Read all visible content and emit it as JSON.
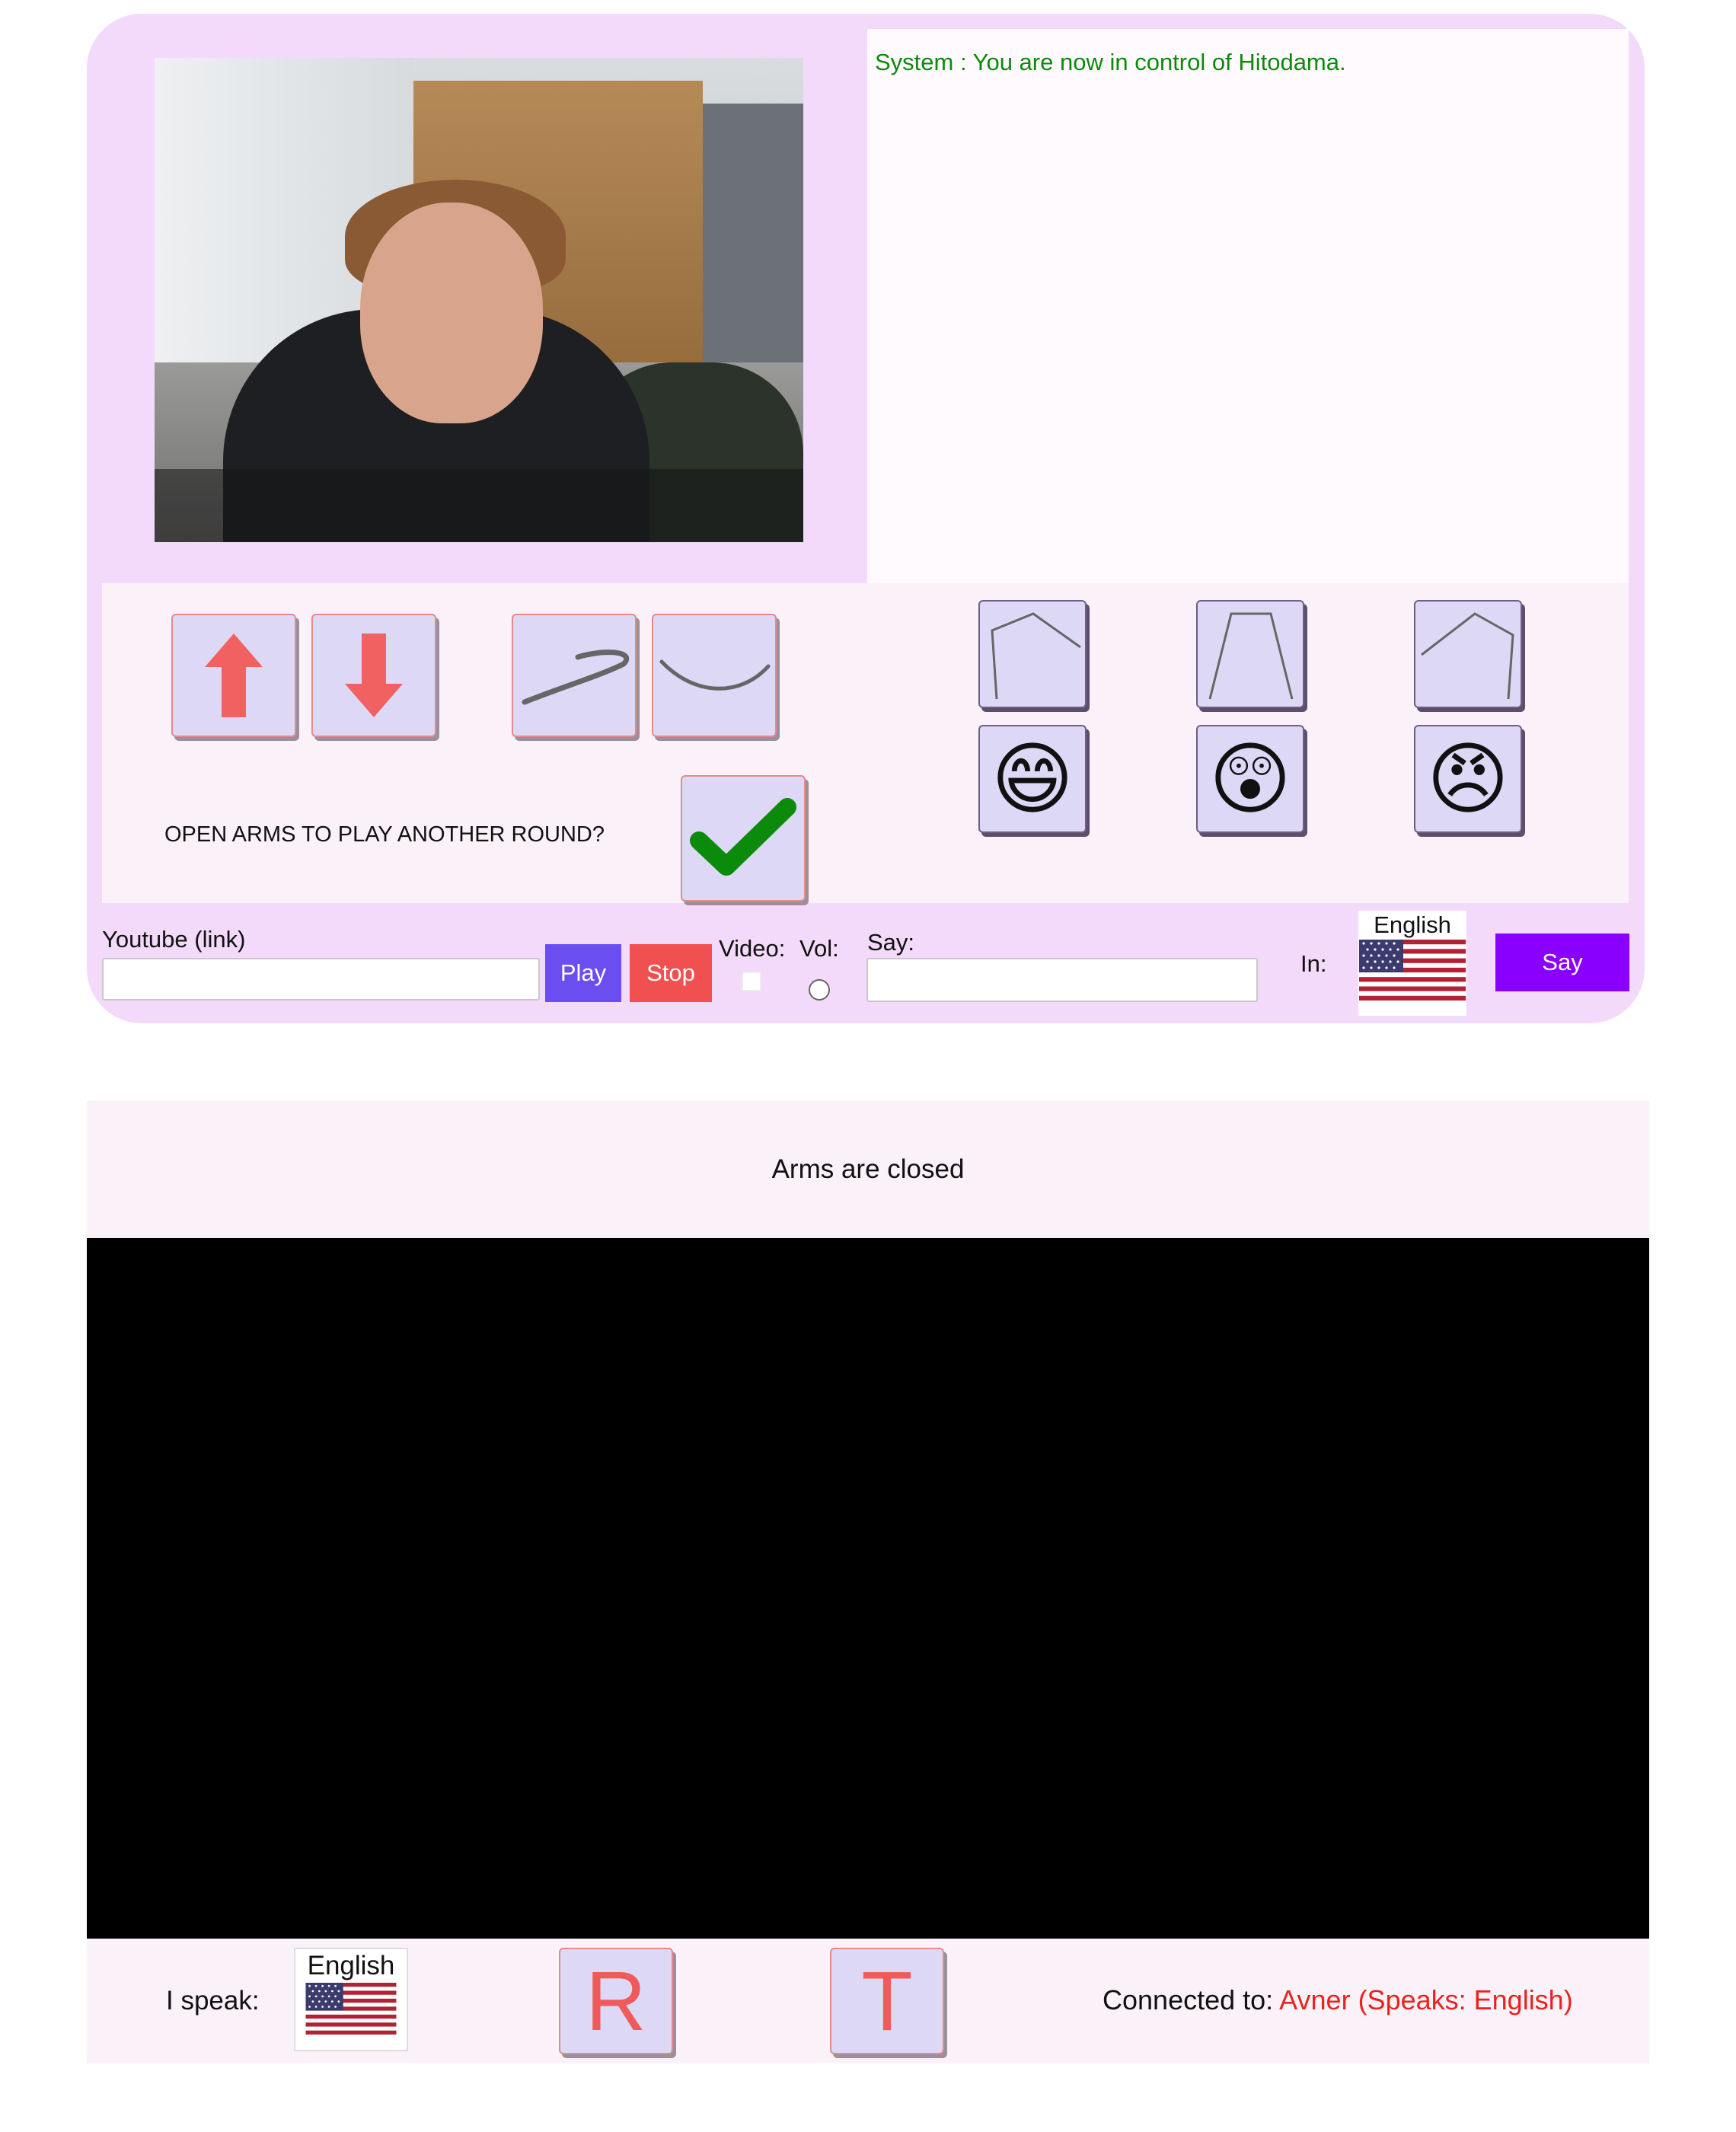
{
  "chat": {
    "messages": [
      {
        "text": "System : You are now in control of Hitodama."
      }
    ]
  },
  "arm_controls": {
    "up_icon": "arrow-up-icon",
    "down_icon": "arrow-down-icon",
    "wave_icon": "wave-icon",
    "curve_icon": "curve-icon"
  },
  "poses": [
    "pose-bent-left-icon",
    "pose-trapezoid-icon",
    "pose-bent-right-icon"
  ],
  "emotions": [
    "😄",
    "😲",
    "😠"
  ],
  "prompt": {
    "text": "OPEN ARMS TO PLAY ANOTHER ROUND?",
    "confirm_icon": "checkmark-icon"
  },
  "youtube": {
    "label": "Youtube (link)",
    "value": "",
    "play_label": "Play",
    "stop_label": "Stop",
    "video_label": "Video:",
    "vol_label": "Vol:"
  },
  "say": {
    "label": "Say:",
    "value": "",
    "in_label": "In:",
    "language": "English",
    "button_label": "Say"
  },
  "status": {
    "text": "Arms are closed"
  },
  "bottom": {
    "i_speak_label": "I speak:",
    "language": "English",
    "r_label": "R",
    "t_label": "T",
    "connected_label": "Connected to:",
    "connected_value": "Avner (Speaks: English)"
  },
  "colors": {
    "panel_bg": "#f3d9fa",
    "play": "#6b4ef0",
    "stop": "#f05050",
    "say": "#8a00ff",
    "chat_system": "#0d8a0d",
    "accent_red": "#ef5b5b",
    "connected": "#e8231d"
  }
}
